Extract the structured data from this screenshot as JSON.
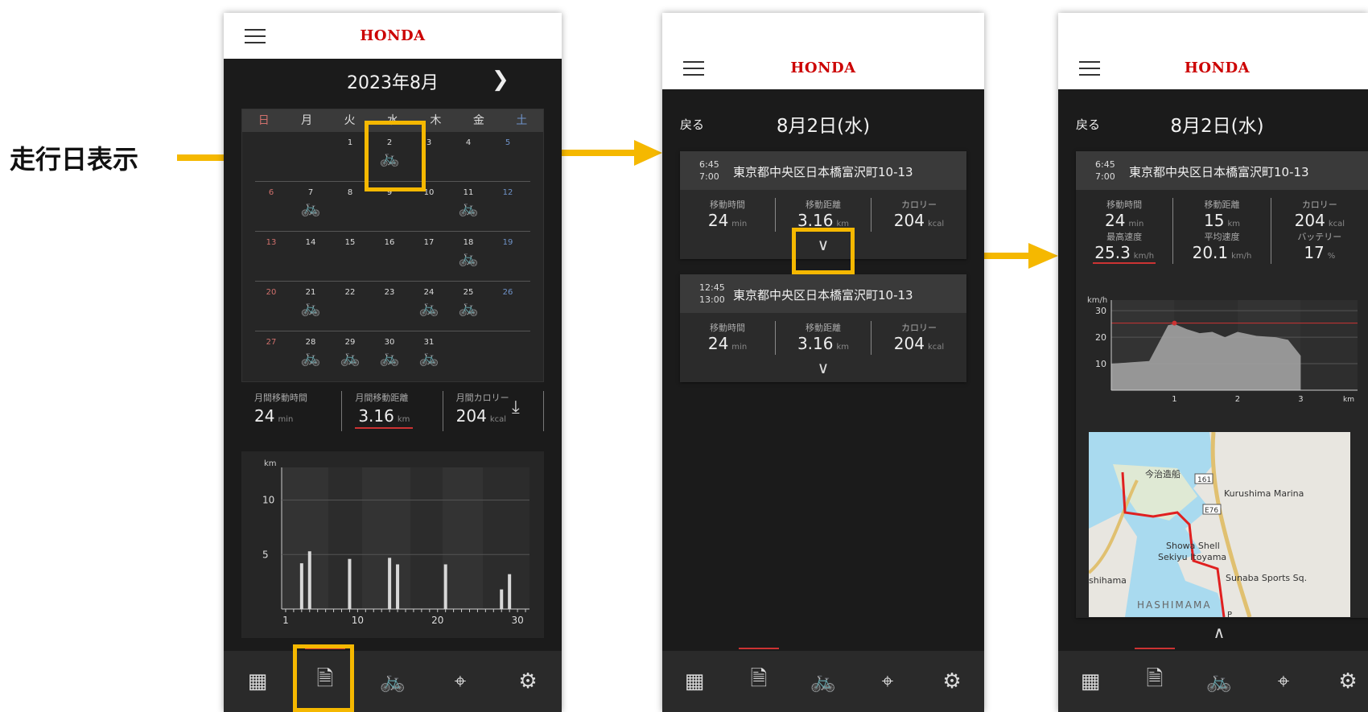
{
  "annotation": {
    "label": "走行日表示",
    "color": "#f5b800"
  },
  "brand": {
    "logo": "HONDA",
    "color": "#cc0000"
  },
  "screen1": {
    "month": "2023年8月",
    "next_icon": "chevron-right-icon",
    "weekdays": [
      "日",
      "月",
      "火",
      "水",
      "木",
      "金",
      "土"
    ],
    "weeks": [
      [
        null,
        null,
        {
          "d": "1"
        },
        {
          "d": "2",
          "bike": true
        },
        {
          "d": "3"
        },
        {
          "d": "4"
        },
        {
          "d": "5"
        }
      ],
      [
        {
          "d": "6"
        },
        {
          "d": "7",
          "bike": true
        },
        {
          "d": "8"
        },
        {
          "d": "9"
        },
        {
          "d": "10"
        },
        {
          "d": "11",
          "bike": true
        },
        {
          "d": "12"
        }
      ],
      [
        {
          "d": "13"
        },
        {
          "d": "14"
        },
        {
          "d": "15"
        },
        {
          "d": "16"
        },
        {
          "d": "17"
        },
        {
          "d": "18",
          "bike": true
        },
        {
          "d": "19"
        }
      ],
      [
        {
          "d": "20"
        },
        {
          "d": "21",
          "bike": true
        },
        {
          "d": "22"
        },
        {
          "d": "23"
        },
        {
          "d": "24",
          "bike": true
        },
        {
          "d": "25",
          "bike": true
        },
        {
          "d": "26"
        }
      ],
      [
        {
          "d": "27"
        },
        {
          "d": "28",
          "bike": true
        },
        {
          "d": "29",
          "bike": true
        },
        {
          "d": "30",
          "bike": true
        },
        {
          "d": "31",
          "bike": true
        },
        null,
        null
      ]
    ],
    "stats": [
      {
        "label": "月間移動時間",
        "value": "24",
        "unit": "min"
      },
      {
        "label": "月間移動距離",
        "value": "3.16",
        "unit": "km"
      },
      {
        "label": "月間カロリー",
        "value": "204",
        "unit": "kcal"
      }
    ],
    "download_icon": "download-icon"
  },
  "chart_data": [
    {
      "type": "bar",
      "ylabel": "km",
      "yticks": [
        5,
        10
      ],
      "xticks": [
        1,
        10,
        20,
        30
      ],
      "x": [
        3,
        4,
        9,
        14,
        15,
        21,
        28,
        29
      ],
      "values": [
        4.2,
        5.3,
        4.6,
        4.7,
        4.1,
        4.1,
        1.8,
        3.2
      ]
    },
    {
      "type": "area",
      "ylabel": "km/h",
      "yticks": [
        10,
        20,
        30
      ],
      "xticks": [
        "1",
        "2",
        "3"
      ],
      "xunit": "km",
      "x": [
        0,
        0.3,
        0.6,
        0.8,
        0.9,
        1.0,
        1.2,
        1.4,
        1.6,
        1.8,
        2.0,
        2.3,
        2.6,
        2.8,
        3.0
      ],
      "values": [
        10,
        10.5,
        11,
        20,
        24.5,
        25,
        23,
        21.5,
        22,
        20,
        22,
        20.5,
        20,
        19,
        13
      ],
      "max_line": 25.3
    }
  ],
  "screen2": {
    "back": "戻る",
    "date": "8月2日(水)",
    "trips": [
      {
        "start": "6:45",
        "end": "7:00",
        "address": "東京都中央区日本橋富沢町10-13",
        "stats": [
          {
            "label": "移動時間",
            "value": "24",
            "unit": "min"
          },
          {
            "label": "移動距離",
            "value": "3.16",
            "unit": "km"
          },
          {
            "label": "カロリー",
            "value": "204",
            "unit": "kcal"
          }
        ]
      },
      {
        "start": "12:45",
        "end": "13:00",
        "address": "東京都中央区日本橋富沢町10-13",
        "stats": [
          {
            "label": "移動時間",
            "value": "24",
            "unit": "min"
          },
          {
            "label": "移動距離",
            "value": "3.16",
            "unit": "km"
          },
          {
            "label": "カロリー",
            "value": "204",
            "unit": "kcal"
          }
        ]
      }
    ]
  },
  "screen3": {
    "back": "戻る",
    "date": "8月2日(水)",
    "trip": {
      "start": "6:45",
      "end": "7:00",
      "address": "東京都中央区日本橋富沢町10-13"
    },
    "stats_row1": [
      {
        "label": "移動時間",
        "value": "24",
        "unit": "min"
      },
      {
        "label": "移動距離",
        "value": "15",
        "unit": "km"
      },
      {
        "label": "カロリー",
        "value": "204",
        "unit": "kcal"
      }
    ],
    "stats_row2": [
      {
        "label": "最高速度",
        "value": "25.3",
        "unit": "km/h"
      },
      {
        "label": "平均速度",
        "value": "20.1",
        "unit": "km/h"
      },
      {
        "label": "バッテリー",
        "value": "17",
        "unit": "%"
      }
    ],
    "map_labels": [
      "今治造船",
      "161",
      "E76",
      "Kurushima Marina",
      "Showa Shell",
      "Sekiyu Itoyama",
      "Sunaba Sports Sq.",
      "shihama",
      "HASHIMAMA",
      "P"
    ]
  },
  "tabbar_icons": [
    "grid-icon",
    "activity-log-icon",
    "bike-speed-icon",
    "location-pin-icon",
    "settings-gear-icon"
  ]
}
